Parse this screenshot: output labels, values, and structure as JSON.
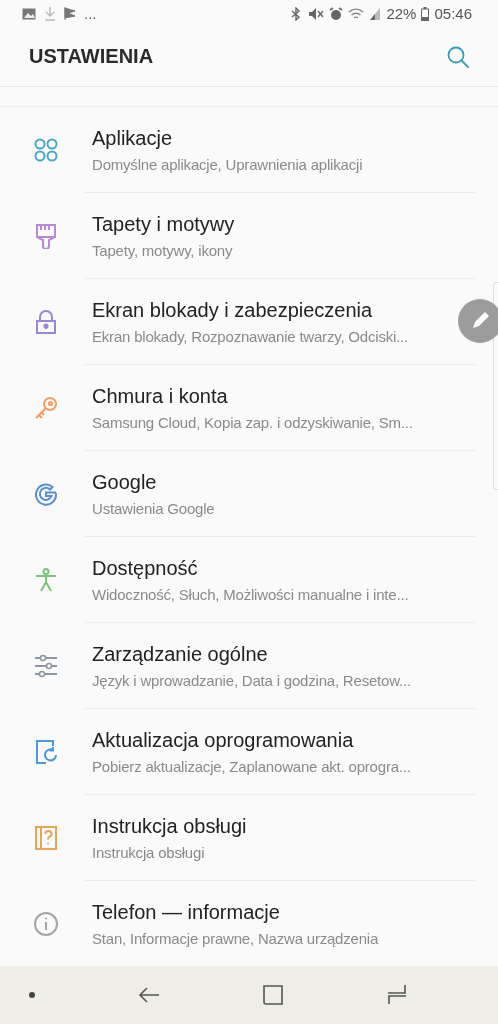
{
  "status_bar": {
    "overflow": "...",
    "battery": "22%",
    "time": "05:46"
  },
  "header": {
    "title": "USTAWIENIA"
  },
  "items": [
    {
      "title": "Aplikacje",
      "subtitle": "Domyślne aplikacje, Uprawnienia aplikacji",
      "color": "#4aa8c4"
    },
    {
      "title": "Tapety i motywy",
      "subtitle": "Tapety, motywy, ikony",
      "color": "#b88ad6"
    },
    {
      "title": "Ekran blokady i zabezpieczenia",
      "subtitle": "Ekran blokady, Rozpoznawanie twarzy, Odciski...",
      "color": "#9a86d6"
    },
    {
      "title": "Chmura i konta",
      "subtitle": "Samsung Cloud, Kopia zap. i odzyskiwanie, Sm...",
      "color": "#f0a064"
    },
    {
      "title": "Google",
      "subtitle": "Ustawienia Google",
      "color": "#5a8ed2"
    },
    {
      "title": "Dostępność",
      "subtitle": "Widoczność, Słuch, Możliwości manualne i inte...",
      "color": "#7cc47c"
    },
    {
      "title": "Zarządzanie ogólne",
      "subtitle": "Język i wprowadzanie, Data i godzina, Resetow...",
      "color": "#8e98a0"
    },
    {
      "title": "Aktualizacja oprogramowania",
      "subtitle": "Pobierz aktualizacje, Zaplanowane akt. oprogra...",
      "color": "#4a9ad8"
    },
    {
      "title": "Instrukcja obsługi",
      "subtitle": "Instrukcja obsługi",
      "color": "#e8a458"
    },
    {
      "title": "Telefon — informacje",
      "subtitle": "Stan, Informacje prawne, Nazwa urządzenia",
      "color": "#a4a4a4"
    }
  ]
}
